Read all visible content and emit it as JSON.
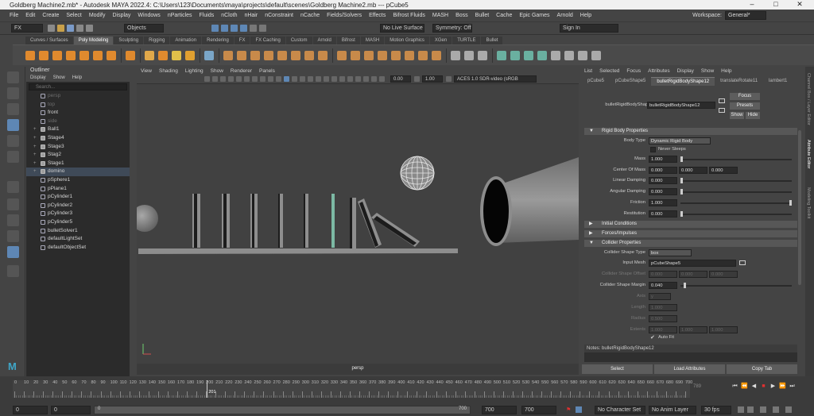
{
  "window": {
    "title": "Goldberg Machine2.mb* - Autodesk MAYA 2022.4: C:\\Users\\123\\Documents\\maya\\projects\\default\\scenes\\Goldberg Machine2.mb   ---   pCube5",
    "minimize": "–",
    "maximize": "□",
    "close": "✕"
  },
  "menubar": {
    "items": [
      "File",
      "Edit",
      "Create",
      "Select",
      "Modify",
      "Display",
      "Windows",
      "nParticles",
      "Fluids",
      "nCloth",
      "nHair",
      "nConstraint",
      "nCache",
      "Fields/Solvers",
      "Effects",
      "Bifrost Fluids",
      "MASH",
      "Boss",
      "Bullet",
      "Cache",
      "Epic Games",
      "Arnold",
      "Help"
    ],
    "workspace_label": "Workspace:",
    "workspace_value": "General*"
  },
  "statusline": {
    "mode": "FX",
    "objects": "Objects",
    "live_surface": "No Live Surface",
    "symmetry": "Symmetry: Off",
    "sign_in": "Sign In"
  },
  "shelf": {
    "tabs": [
      "Curves / Surfaces",
      "Poly Modeling",
      "Sculpting",
      "Rigging",
      "Animation",
      "Rendering",
      "FX",
      "FX Caching",
      "Custom",
      "Arnold",
      "Bifrost",
      "MASH",
      "Motion Graphics",
      "XGen",
      "TURTLE",
      "Bullet"
    ],
    "active_tab": "Poly Modeling"
  },
  "outliner": {
    "title": "Outliner",
    "menu": [
      "Display",
      "Show",
      "Help"
    ],
    "search_placeholder": "Search...",
    "items": [
      {
        "label": "persp",
        "state": "dim",
        "icon": "camera"
      },
      {
        "label": "top",
        "state": "dim",
        "icon": "camera"
      },
      {
        "label": "front",
        "state": "normal",
        "icon": "camera"
      },
      {
        "label": "side",
        "state": "dim",
        "icon": "camera"
      },
      {
        "label": "Ball1",
        "state": "normal",
        "icon": "group"
      },
      {
        "label": "Stage4",
        "state": "normal",
        "icon": "group"
      },
      {
        "label": "Stage3",
        "state": "normal",
        "icon": "group"
      },
      {
        "label": "Stag2",
        "state": "normal",
        "icon": "group"
      },
      {
        "label": "Stage1",
        "state": "normal",
        "icon": "group"
      },
      {
        "label": "domino",
        "state": "selected",
        "icon": "group"
      },
      {
        "label": "pSphere1",
        "state": "normal",
        "icon": "mesh"
      },
      {
        "label": "pPlane1",
        "state": "normal",
        "icon": "mesh"
      },
      {
        "label": "pCylinder1",
        "state": "normal",
        "icon": "mesh"
      },
      {
        "label": "pCylinder2",
        "state": "normal",
        "icon": "mesh"
      },
      {
        "label": "pCylinder3",
        "state": "normal",
        "icon": "mesh"
      },
      {
        "label": "pCylinder5",
        "state": "normal",
        "icon": "mesh"
      },
      {
        "label": "bulletSolver1",
        "state": "normal",
        "icon": "solver"
      },
      {
        "label": "defaultLightSet",
        "state": "normal",
        "icon": "set"
      },
      {
        "label": "defaultObjectSet",
        "state": "normal",
        "icon": "set"
      }
    ]
  },
  "viewport": {
    "menu": [
      "View",
      "Shading",
      "Lighting",
      "Show",
      "Renderer",
      "Panels"
    ],
    "value_a": "0.00",
    "value_b": "1.00",
    "color_space": "ACES 1.0 SDR-video (sRGB",
    "camera_label": "persp"
  },
  "attribute_editor": {
    "menu": [
      "List",
      "Selected",
      "Focus",
      "Attributes",
      "Display",
      "Show",
      "Help"
    ],
    "tabs": [
      "pCube5",
      "pCubeShape5",
      "bulletRigidBodyShape12",
      "translateRotate11",
      "lambert1"
    ],
    "active_tab": "bulletRigidBodyShape12",
    "node_label": "bulletRigidBodyShape:",
    "node_value": "bulletRigidBodyShape12",
    "focus_button": "Focus",
    "presets_button": "Presets",
    "show_button": "Show",
    "hide_button": "Hide",
    "sections": {
      "rigid_body": "Rigid Body Properties",
      "initial": "Initial Conditions",
      "forces": "Forces/Impulses",
      "collider": "Collider Properties"
    },
    "body_type_label": "Body Type",
    "body_type_value": "Dynamic Rigid Body",
    "never_sleeps": "Never Sleeps",
    "rows": [
      {
        "label": "Mass",
        "values": [
          "1.000"
        ],
        "slider": 0.0
      },
      {
        "label": "Center Of Mass",
        "values": [
          "0.000",
          "0.000",
          "0.000"
        ]
      },
      {
        "label": "Linear Damping",
        "values": [
          "0.000"
        ],
        "slider": 0.0
      },
      {
        "label": "Angular Damping",
        "values": [
          "0.000"
        ],
        "slider": 0.0
      },
      {
        "label": "Friction",
        "values": [
          "1.000"
        ],
        "slider": 1.0
      },
      {
        "label": "Restitution",
        "values": [
          "0.000"
        ],
        "slider": 0.0
      }
    ],
    "collider": {
      "shape_type_label": "Collider Shape Type",
      "shape_type_value": "box",
      "input_mesh_label": "Input Mesh",
      "input_mesh_value": "pCubeShape5",
      "offset_label": "Collider Shape Offset",
      "offset_values": [
        "0.000",
        "0.000",
        "0.000"
      ],
      "margin_label": "Collider Shape Margin",
      "margin_value": "0.040",
      "axis_label": "Axis",
      "axis_value": "y",
      "length_label": "Length",
      "length_value": "1.000",
      "radius_label": "Radius",
      "radius_value": "0.500",
      "extents_label": "Extents",
      "extents_values": [
        "1.000",
        "1.000",
        "1.000"
      ],
      "auto_fit": "Auto Fit"
    },
    "notes": "Notes:  bulletRigidBodyShape12",
    "bottom_buttons": [
      "Select",
      "Load Attributes",
      "Copy Tab"
    ],
    "side_tabs": [
      "Channel Box / Layer Editor",
      "Attribute Editor",
      "Modeling Toolkit"
    ]
  },
  "timeline": {
    "ticks": [
      0,
      10,
      20,
      30,
      40,
      50,
      60,
      70,
      80,
      90,
      100,
      110,
      120,
      130,
      140,
      150,
      160,
      170,
      180,
      190,
      200,
      210,
      220,
      230,
      240,
      250,
      260,
      270,
      280,
      290,
      300,
      310,
      320,
      330,
      340,
      350,
      360,
      370,
      380,
      390,
      400,
      410,
      420,
      430,
      440,
      450,
      460,
      470,
      480,
      490,
      500,
      510,
      520,
      530,
      540,
      550,
      560,
      570,
      580,
      590,
      600,
      610,
      620,
      630,
      640,
      650,
      660,
      670,
      680,
      690,
      700
    ],
    "current_frame": "201",
    "current_frame_value": 201,
    "max_frame": 700,
    "right_field": "789"
  },
  "range": {
    "start": "0",
    "start_inner": "0",
    "slider_start": "0",
    "slider_end": "700",
    "end_inner": "700",
    "end": "700",
    "character_set": "No Character Set",
    "anim_layer": "No Anim Layer",
    "fps": "30 fps"
  }
}
